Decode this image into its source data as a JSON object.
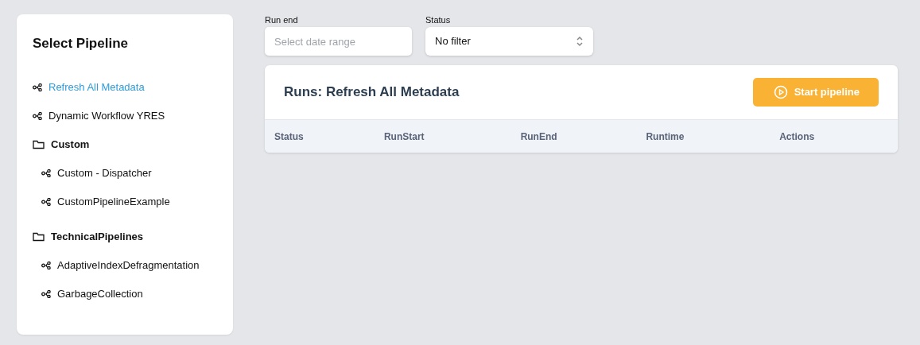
{
  "sidebar": {
    "title": "Select Pipeline",
    "items": [
      {
        "kind": "pipeline",
        "label": "Refresh All Metadata",
        "selected": true
      },
      {
        "kind": "pipeline",
        "label": "Dynamic Workflow YRES",
        "selected": false
      },
      {
        "kind": "folder",
        "label": "Custom",
        "children": [
          {
            "kind": "pipeline",
            "label": "Custom - Dispatcher",
            "selected": false
          },
          {
            "kind": "pipeline",
            "label": "CustomPipelineExample",
            "selected": false
          }
        ]
      },
      {
        "kind": "folder",
        "label": "TechnicalPipelines",
        "children": [
          {
            "kind": "pipeline",
            "label": "AdaptiveIndexDefragmentation",
            "selected": false
          },
          {
            "kind": "pipeline",
            "label": "GarbageCollection",
            "selected": false
          }
        ]
      }
    ]
  },
  "filters": {
    "run_end": {
      "label": "Run end",
      "placeholder": "Select date range"
    },
    "status": {
      "label": "Status",
      "value": "No filter"
    }
  },
  "runs": {
    "title": "Runs: Refresh All Metadata",
    "start_button": "Start pipeline",
    "columns": [
      "Status",
      "RunStart",
      "RunEnd",
      "Runtime",
      "Actions"
    ]
  }
}
